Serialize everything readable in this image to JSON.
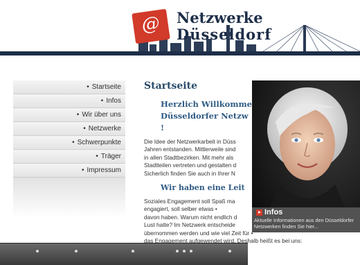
{
  "header": {
    "logo_letter": "@",
    "title_line1": "Netzwerke",
    "title_line2": "Düsseldorf"
  },
  "sidebar": {
    "items": [
      {
        "label": "Startseite"
      },
      {
        "label": "Infos"
      },
      {
        "label": "Wir über uns"
      },
      {
        "label": "Netzwerke"
      },
      {
        "label": "Schwerpunkte"
      },
      {
        "label": "Träger"
      },
      {
        "label": "Impressum"
      }
    ]
  },
  "main": {
    "page_title": "Startseite",
    "welcome_lines": [
      "Herzlich Willkomme",
      "Düsseldorfer Netzw",
      "!"
    ],
    "intro_lines": [
      "Die Idee der Netzwerkarbeit in Düss",
      "Jahren entstanden. Mittlerweile sind",
      "in allen Stadtbezirken. Mit mehr als",
      "Stadtteilen vertreten und gestalten d",
      "Sicherlich finden Sie auch in Ihrer N"
    ],
    "subheading": "Wir haben eine Leit",
    "body_lines": [
      "Soziales Engagement soll Spaß ma",
      "engagiert, soll selber etwas •",
      "davon haben. Warum nicht endlich d",
      "Lust hatte? Im Netzwerk entscheide",
      "übernommen werden und wie viel Zeit für •",
      "das Engagement aufgewendet wird. Deshalb heißt es bei uns:"
    ]
  },
  "overlay": {
    "label": "Infos",
    "caption": "Aktuelle Informationen aus den Düsseldorfer Netzwerken finden Sie hier..."
  },
  "colors": {
    "brand_red": "#d23a2a",
    "brand_navy": "#1e2e48",
    "heading_blue": "#2f5b84"
  }
}
